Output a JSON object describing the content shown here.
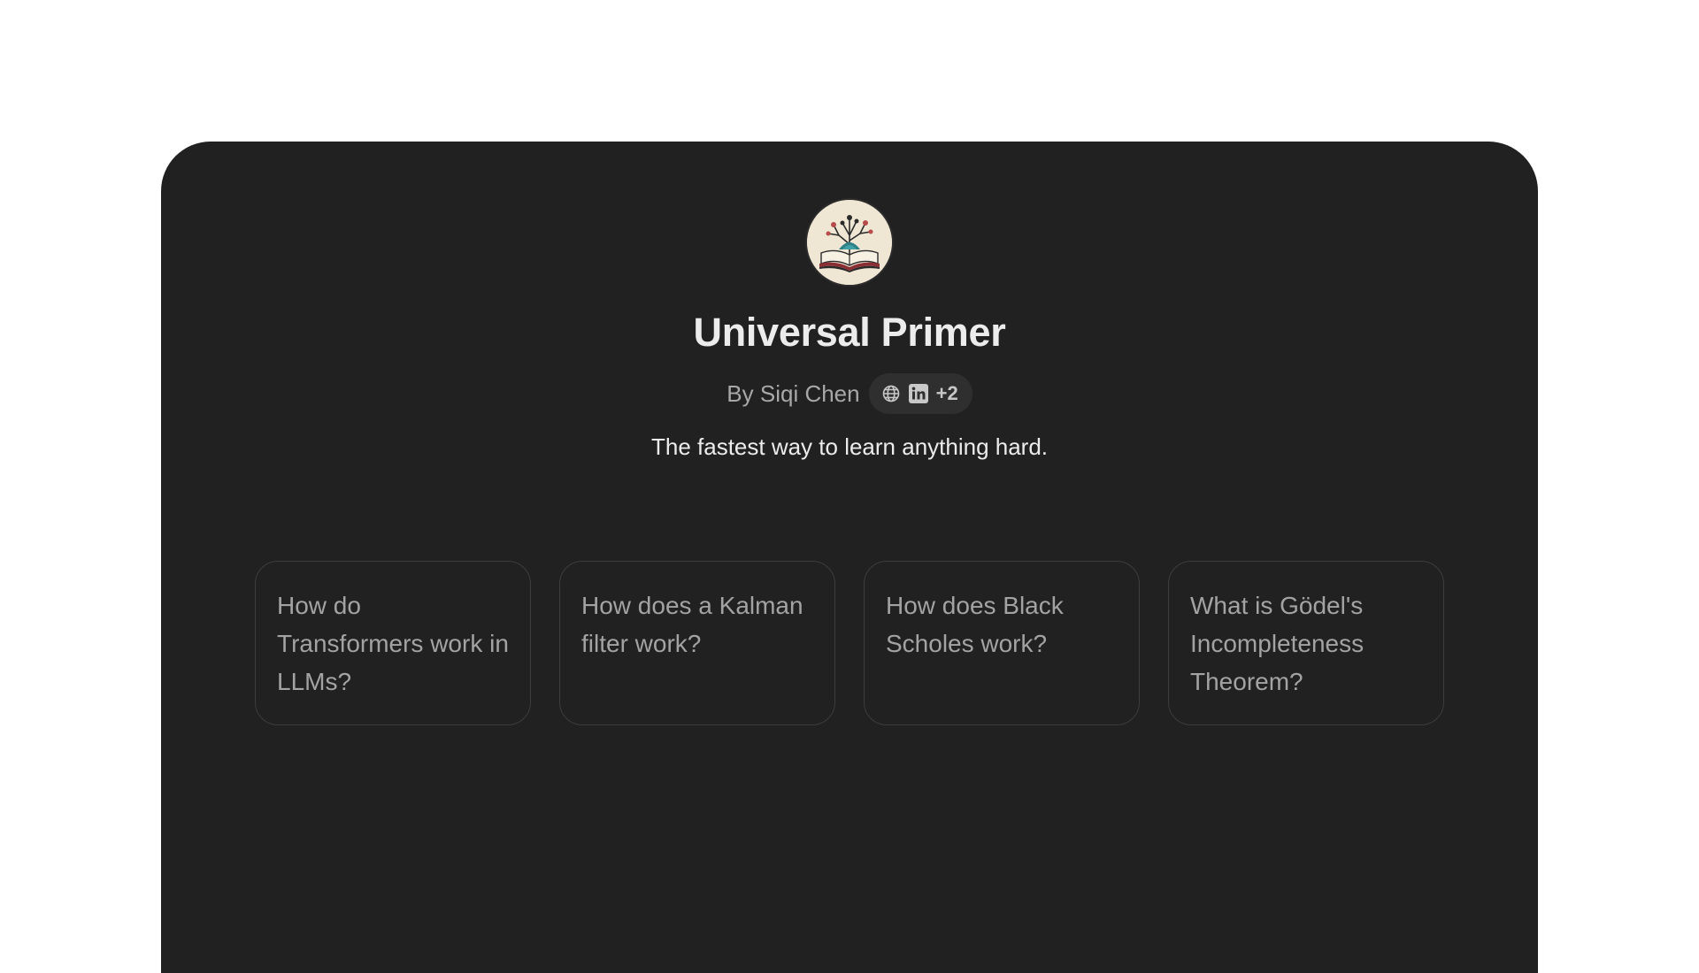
{
  "gpt": {
    "name": "Universal Primer",
    "author": "By Siqi Chen",
    "social_extra": "+2",
    "description": "The fastest way to learn anything hard."
  },
  "icons": {
    "avatar": "open-book-tree-circuit-icon",
    "website": "globe-icon",
    "linkedin": "linkedin-icon"
  },
  "prompts": [
    "How do Transformers work in LLMs?",
    "How does a Kalman filter work?",
    "How does Black Scholes work?",
    "What is Gödel's Incompleteness Theorem?"
  ],
  "colors": {
    "page_background": "#ffffff",
    "panel_background": "#212121",
    "title_text": "#ececec",
    "muted_text": "#a8a8a8",
    "card_border": "#3d3d3d",
    "pill_background": "#2f2f2f"
  }
}
